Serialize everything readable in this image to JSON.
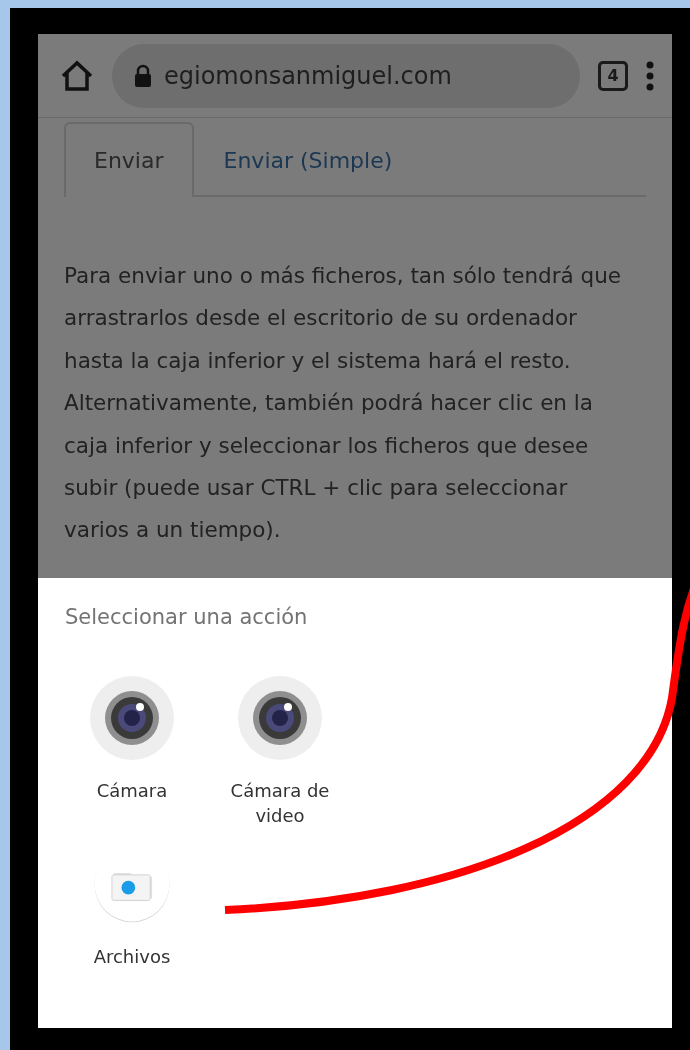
{
  "browser": {
    "url": "egiomonsanmiguel.com",
    "tab_count": "4"
  },
  "tabs": [
    {
      "label": "Enviar",
      "selected": true
    },
    {
      "label": "Enviar (Simple)",
      "selected": false
    }
  ],
  "paragraph": "Para enviar uno o más ficheros, tan sólo tendrá que arrastrarlos desde el escritorio de su ordenador hasta la caja inferior y el sistema hará el resto. Alternativamente, también podrá hacer clic en la caja inferior y seleccionar los ficheros que desee subir (puede usar CTRL + clic para seleccionar varios a un tiempo).",
  "sheet": {
    "title": "Seleccionar una acción",
    "actions": [
      {
        "label": "Cámara",
        "kind": "camera"
      },
      {
        "label": "Cámara de video",
        "kind": "camera"
      },
      {
        "label": "Archivos",
        "kind": "files"
      }
    ]
  }
}
